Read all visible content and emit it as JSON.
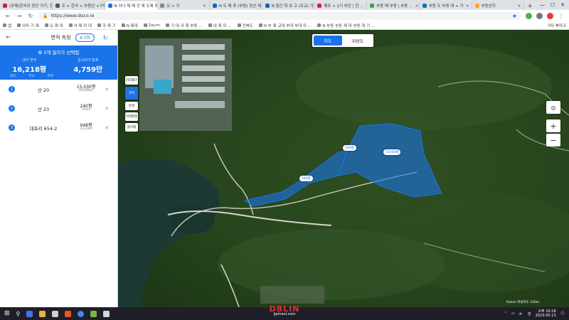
{
  "browser": {
    "tabs": [
      {
        "label": "(무제)한국의 장단 가기, 한국 …",
        "color": "#c62828"
      },
      {
        "label": "조 + 한국 + 부동산 +구매",
        "color": "#555555"
      },
      {
        "label": "N 이나 제 제 간 제 도제 제 …",
        "color": "#1a73e8",
        "active": true
      },
      {
        "label": "오 + 가",
        "color": "#888888"
      },
      {
        "label": "N 도 매 후 (부동) 정산 제 가 …",
        "color": "#1565c0"
      },
      {
        "label": "N 중간 화 보 고 (조교) 가 …",
        "color": "#1565c0"
      },
      {
        "label": "해조 + 2기 차단 | 한 …",
        "color": "#d81b60"
      },
      {
        "label": "부동 매 부동 | 부동 …",
        "color": "#43a047"
      },
      {
        "label": "부동 도 부동 대 + 가",
        "color": "#0277bd"
      },
      {
        "label": "부동산지",
        "color": "#f9a825"
      }
    ],
    "url": "https://www.disco.re",
    "bookmarks": [
      "앱",
      "아마 기 제",
      "오 제 대",
      "서 제 외 대",
      "국 제 기",
      "N 제대",
      "Daum",
      "기 대 국 제 부동 …",
      "내 제 되 …",
      "전북도",
      "N 부 제 교대 부대 부대 자 …",
      "N 부동 부동 제 대 부동 대 기 …"
    ],
    "bookmarks_right": "기타 북마크"
  },
  "panel": {
    "title": "면적 측정",
    "reset_label": "초기화",
    "summary_title": "✿ 3개 필지가 선택됨",
    "total_area_label": "대지 면적",
    "total_area_value": "16,218평",
    "price_label": "공시지가 합계",
    "price_value": "4,759만",
    "foot_left": "번호",
    "foot_mid": "주소",
    "foot_right": "면적",
    "parcels": [
      {
        "num": "1",
        "addr": "산 20",
        "area": "15,030평",
        "sub": "49,686㎡"
      },
      {
        "num": "2",
        "addr": "산 23",
        "area": "240평",
        "sub": "793㎡"
      },
      {
        "num": "3",
        "addr": "대포리 654-2",
        "area": "948평",
        "sub": "3,134㎡"
      }
    ]
  },
  "map": {
    "toggle_map": "지도",
    "toggle_sat": "위성도",
    "tools": [
      "거리재기",
      "면적",
      "반경",
      "지적편집",
      "실거래"
    ],
    "pins": [
      {
        "label": "240평"
      },
      {
        "label": "15030평"
      },
      {
        "label": "948평"
      }
    ],
    "scale": "Kakao  위성지도  100m",
    "parcel_color": "#1a73e8"
  },
  "taskbar": {
    "watermark_top": "DBLIN",
    "watermark_bottom": "jipmani.com",
    "time": "오후 10:18",
    "date": "2023-05-13",
    "lang": "한"
  }
}
